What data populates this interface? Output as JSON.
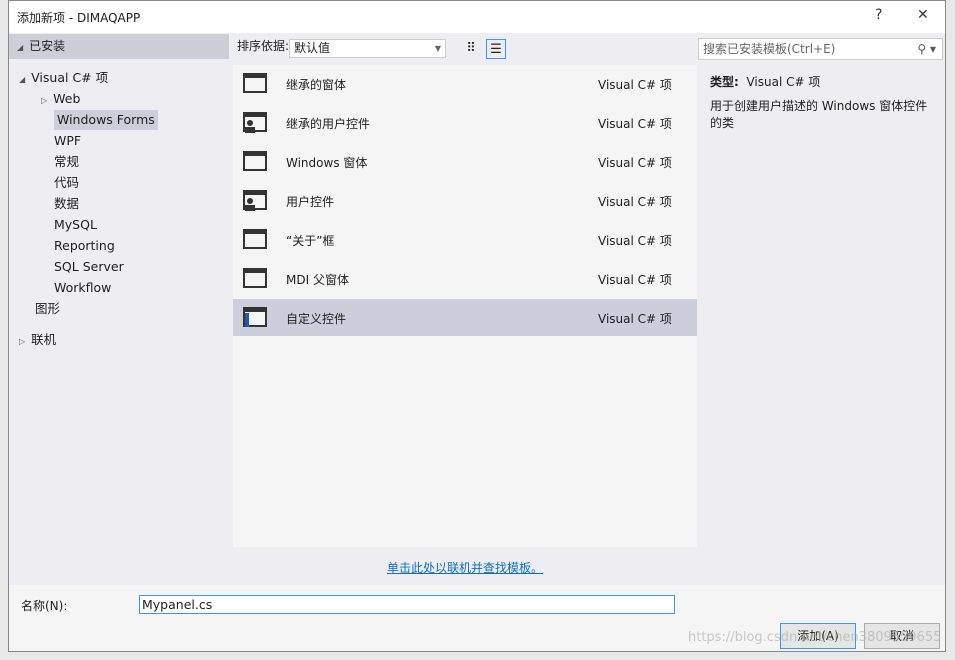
{
  "window": {
    "title": "添加新项 - DIMAQAPP",
    "help": "?",
    "close": "✕"
  },
  "left": {
    "header": "已安装",
    "root": "Visual C# 项",
    "items": [
      "Web",
      "Windows Forms",
      "WPF",
      "常规",
      "代码",
      "数据",
      "MySQL",
      "Reporting",
      "SQL Server",
      "Workflow"
    ],
    "graphics": "图形",
    "online": "联机"
  },
  "toolbar": {
    "sort_label": "排序依据:",
    "sort_value": "默认值"
  },
  "search": {
    "placeholder": "搜索已安装模板(Ctrl+E)"
  },
  "templates": [
    {
      "name": "继承的窗体",
      "type": "Visual C# 项",
      "icon": "inherited-form-icon"
    },
    {
      "name": "继承的用户控件",
      "type": "Visual C# 项",
      "icon": "inherited-user-control-icon"
    },
    {
      "name": "Windows 窗体",
      "type": "Visual C# 项",
      "icon": "windows-form-icon"
    },
    {
      "name": "用户控件",
      "type": "Visual C# 项",
      "icon": "user-control-icon"
    },
    {
      "name": "“关于”框",
      "type": "Visual C# 项",
      "icon": "about-box-icon"
    },
    {
      "name": "MDI 父窗体",
      "type": "Visual C# 项",
      "icon": "mdi-parent-icon"
    },
    {
      "name": "自定义控件",
      "type": "Visual C# 项",
      "icon": "custom-control-icon",
      "selected": true
    }
  ],
  "details": {
    "type_label": "类型:",
    "type_value": "Visual C# 项",
    "description": "用于创建用户描述的 Windows 窗体控件的类"
  },
  "online_link": "单击此处以联机并查找模板。",
  "name_field": {
    "label": "名称(N):",
    "value": "Mypanel.cs"
  },
  "buttons": {
    "add": "添加(A)",
    "cancel": "取消"
  },
  "watermark": "https://blog.csdn.net/chen3809559655"
}
